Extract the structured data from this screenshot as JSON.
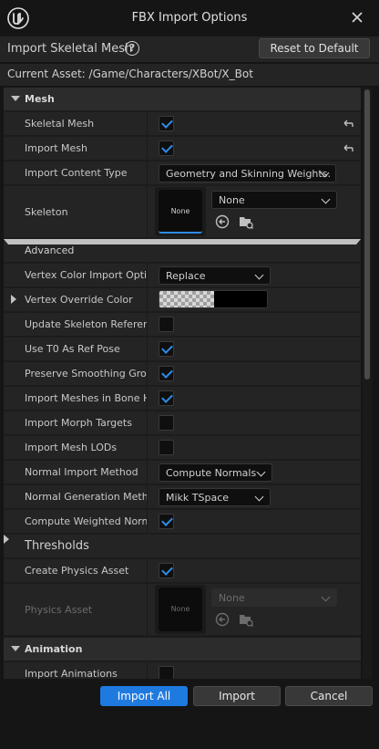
{
  "window": {
    "title": "FBX Import Options"
  },
  "header": {
    "label": "Import Skeletal Mesh",
    "reset_label": "Reset to Default"
  },
  "asset": {
    "text": "Current Asset:  /Game/Characters/XBot/X_Bot"
  },
  "sections": {
    "mesh": "Mesh",
    "advanced": "Advanced",
    "thresholds": "Thresholds",
    "animation": "Animation"
  },
  "props": {
    "skeletal_mesh": {
      "label": "Skeletal Mesh",
      "checked": true
    },
    "import_mesh": {
      "label": "Import Mesh",
      "checked": true
    },
    "import_content_type": {
      "label": "Import Content Type",
      "value": "Geometry and Skinning Weights."
    },
    "skeleton": {
      "label": "Skeleton",
      "thumb": "None",
      "value": "None"
    },
    "vertex_color_import": {
      "label": "Vertex Color Import Option",
      "value": "Replace"
    },
    "vertex_override_color": {
      "label": "Vertex Override Color"
    },
    "update_skeleton_ref": {
      "label": "Update Skeleton Reference Pose",
      "checked": false
    },
    "use_t0": {
      "label": "Use T0 As Ref Pose",
      "checked": true
    },
    "preserve_smoothing": {
      "label": "Preserve Smoothing Groups",
      "checked": true
    },
    "import_meshes_bone": {
      "label": "Import Meshes in Bone Hierarchy",
      "checked": true
    },
    "import_morph": {
      "label": "Import Morph Targets",
      "checked": false
    },
    "import_lods": {
      "label": "Import Mesh LODs",
      "checked": false
    },
    "normal_import": {
      "label": "Normal Import Method",
      "value": "Compute Normals"
    },
    "normal_generation": {
      "label": "Normal Generation Method",
      "value": "Mikk TSpace"
    },
    "compute_weighted": {
      "label": "Compute Weighted Normals",
      "checked": true
    },
    "create_physics": {
      "label": "Create Physics Asset",
      "checked": true
    },
    "physics_asset": {
      "label": "Physics Asset",
      "thumb": "None",
      "value": "None"
    },
    "import_animations": {
      "label": "Import Animations",
      "checked": false
    }
  },
  "footer": {
    "import_all": "Import All",
    "import": "Import",
    "cancel": "Cancel"
  },
  "colors": {
    "accent": "#1f7ae0",
    "check": "#2f8ce8",
    "panel": "#242424",
    "section": "#2c2c2c"
  }
}
